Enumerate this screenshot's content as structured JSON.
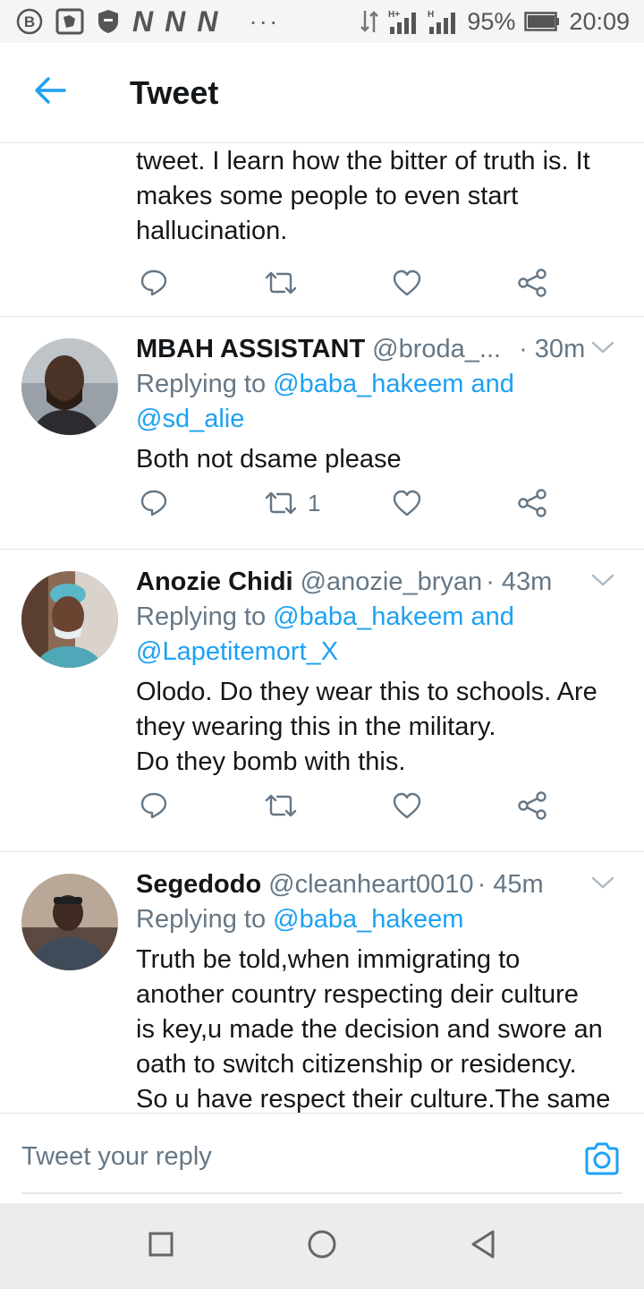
{
  "status_bar": {
    "network_label": "N",
    "dots": "···",
    "battery_pct": "95%",
    "time": "20:09"
  },
  "header": {
    "title": "Tweet"
  },
  "tweets": [
    {
      "text_lines": [
        "tweet. I learn how the bitter of truth is. It",
        "makes some people to even start",
        "hallucination."
      ],
      "retweet_count": ""
    },
    {
      "name": "MBAH ASSISTANT",
      "handle": "@broda_...",
      "time": "· 30m",
      "replying_prefix": "Replying to",
      "mentions_line1": "@baba_hakeem and",
      "mentions_line2": "@sd_alie",
      "text_lines": [
        "Both not dsame please"
      ],
      "retweet_count": "1"
    },
    {
      "name": "Anozie Chidi",
      "handle": "@anozie_bryan",
      "time": "· 43m",
      "replying_prefix": "Replying to",
      "mentions_line1": "@baba_hakeem and",
      "mentions_line2": "@Lapetitemort_X",
      "text_lines": [
        "Olodo. Do they wear this to schools. Are",
        "they wearing this in the military.",
        "Do they bomb with this."
      ],
      "retweet_count": ""
    },
    {
      "name": "Segedodo",
      "handle": "@cleanheart0010",
      "time": "· 45m",
      "replying_prefix": "Replying to",
      "mentions_line1": "@baba_hakeem",
      "text_lines": [
        "Truth be told,when immigrating to",
        "another country respecting deir culture",
        "is key,u made the decision and swore an",
        "oath to switch citizenship or residency.",
        "So u have respect their culture.The same"
      ]
    }
  ],
  "reply_bar": {
    "placeholder": "Tweet your reply"
  },
  "colors": {
    "accent": "#1da1f2",
    "text": "#14171a",
    "muted": "#657786",
    "divider": "#dfe3e6"
  },
  "icons": [
    "back-arrow-icon",
    "reply-icon",
    "retweet-icon",
    "like-icon",
    "share-icon",
    "caret-down-icon",
    "camera-icon",
    "nav-recents-icon",
    "nav-home-icon",
    "nav-back-icon"
  ]
}
